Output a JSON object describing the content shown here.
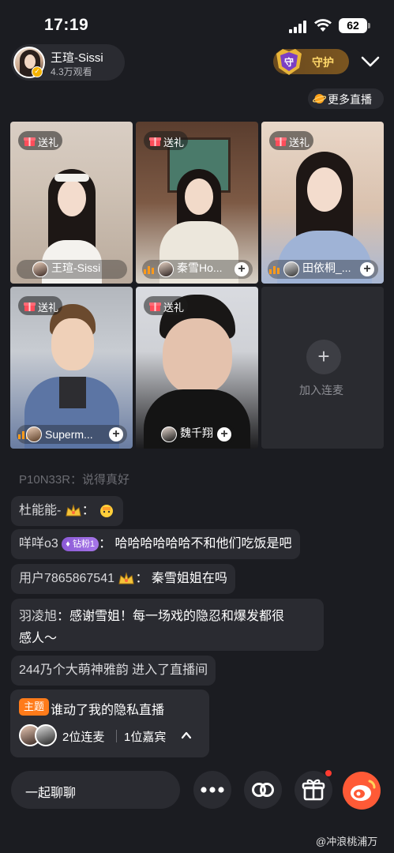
{
  "status_bar": {
    "time": "17:19",
    "battery": "62"
  },
  "host": {
    "name": "王瑄-Sissi",
    "viewers": "4.3万观看",
    "guard_label": "守护",
    "guard_shield_text": "守"
  },
  "more_live_label": "更多直播",
  "tiles": [
    {
      "gift_label": "送礼",
      "name": "王瑄-Sissi"
    },
    {
      "gift_label": "送礼",
      "name": "秦雪Ho..."
    },
    {
      "gift_label": "送礼",
      "name": "田依桐_..."
    },
    {
      "gift_label": "送礼",
      "name": "Superm..."
    },
    {
      "gift_label": "送礼",
      "name": "魏千翔"
    }
  ],
  "join_label": "加入连麦",
  "chat": {
    "faded": "P10N33R：说得真好",
    "messages": [
      {
        "nick": "杜能能-",
        "text": ""
      },
      {
        "nick": "咩咩o3",
        "badge": "钻粉1",
        "text": "哈哈哈哈哈哈不和他们吃饭是吧"
      },
      {
        "nick": "用户7865867541",
        "text": "秦雪姐姐在吗"
      },
      {
        "nick": "羽凌旭",
        "text_line1": "感谢雪姐！每一场戏的隐忍和爆发都很",
        "text_line2": "感人～"
      },
      {
        "system": "244乃个大萌神雅韵 进入了直播间"
      }
    ]
  },
  "topic": {
    "tag": "主题",
    "title": "谁动了我的隐私直播",
    "cohost": "2位连麦",
    "guest": "1位嘉宾"
  },
  "bottom": {
    "chat_placeholder": "一起聊聊"
  },
  "watermark": "@冲浪桃浦万",
  "colors": {
    "background": "#1b1c21",
    "accent_orange": "#ff7b1a",
    "guard_gold": "#ffd86a",
    "weibo_red": "#ff5a36"
  }
}
